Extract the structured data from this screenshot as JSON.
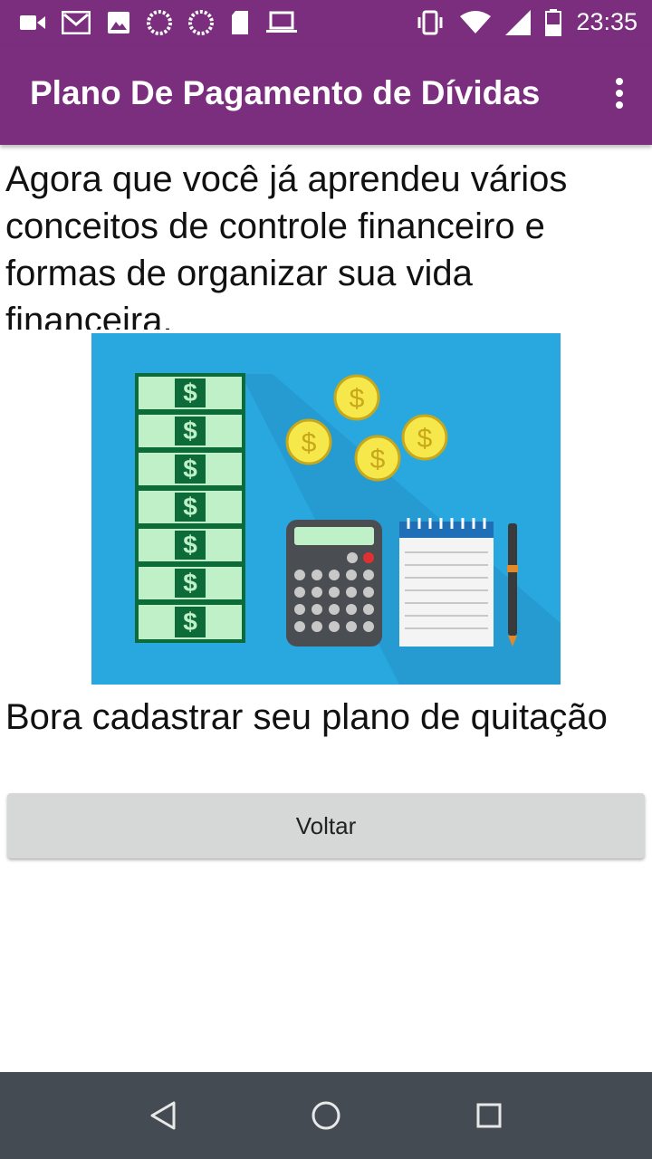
{
  "status_bar": {
    "time": "23:35",
    "left_icons": [
      "video-icon",
      "gmail-icon",
      "image-icon",
      "spinner-icon",
      "spinner-icon",
      "sd-card-icon",
      "laptop-icon"
    ],
    "right_icons": [
      "vibrate-icon",
      "wifi-icon",
      "signal-icon",
      "battery-icon"
    ],
    "color": "#7b2d7e"
  },
  "app_bar": {
    "title": "Plano De Pagamento de Dívidas",
    "menu_icon": "more-vert-icon",
    "color": "#7b2d7e"
  },
  "content": {
    "intro_text": "Agora que você já aprendeu vários conceitos de controle financeiro e formas de organizar sua vida financeira.",
    "image": "finance-illustration",
    "cta_text": "Bora cadastrar seu plano de quitação",
    "back_button_label": "Voltar"
  },
  "nav_bar": {
    "buttons": [
      "back-icon",
      "home-icon",
      "recents-icon"
    ],
    "color": "#454b52"
  }
}
